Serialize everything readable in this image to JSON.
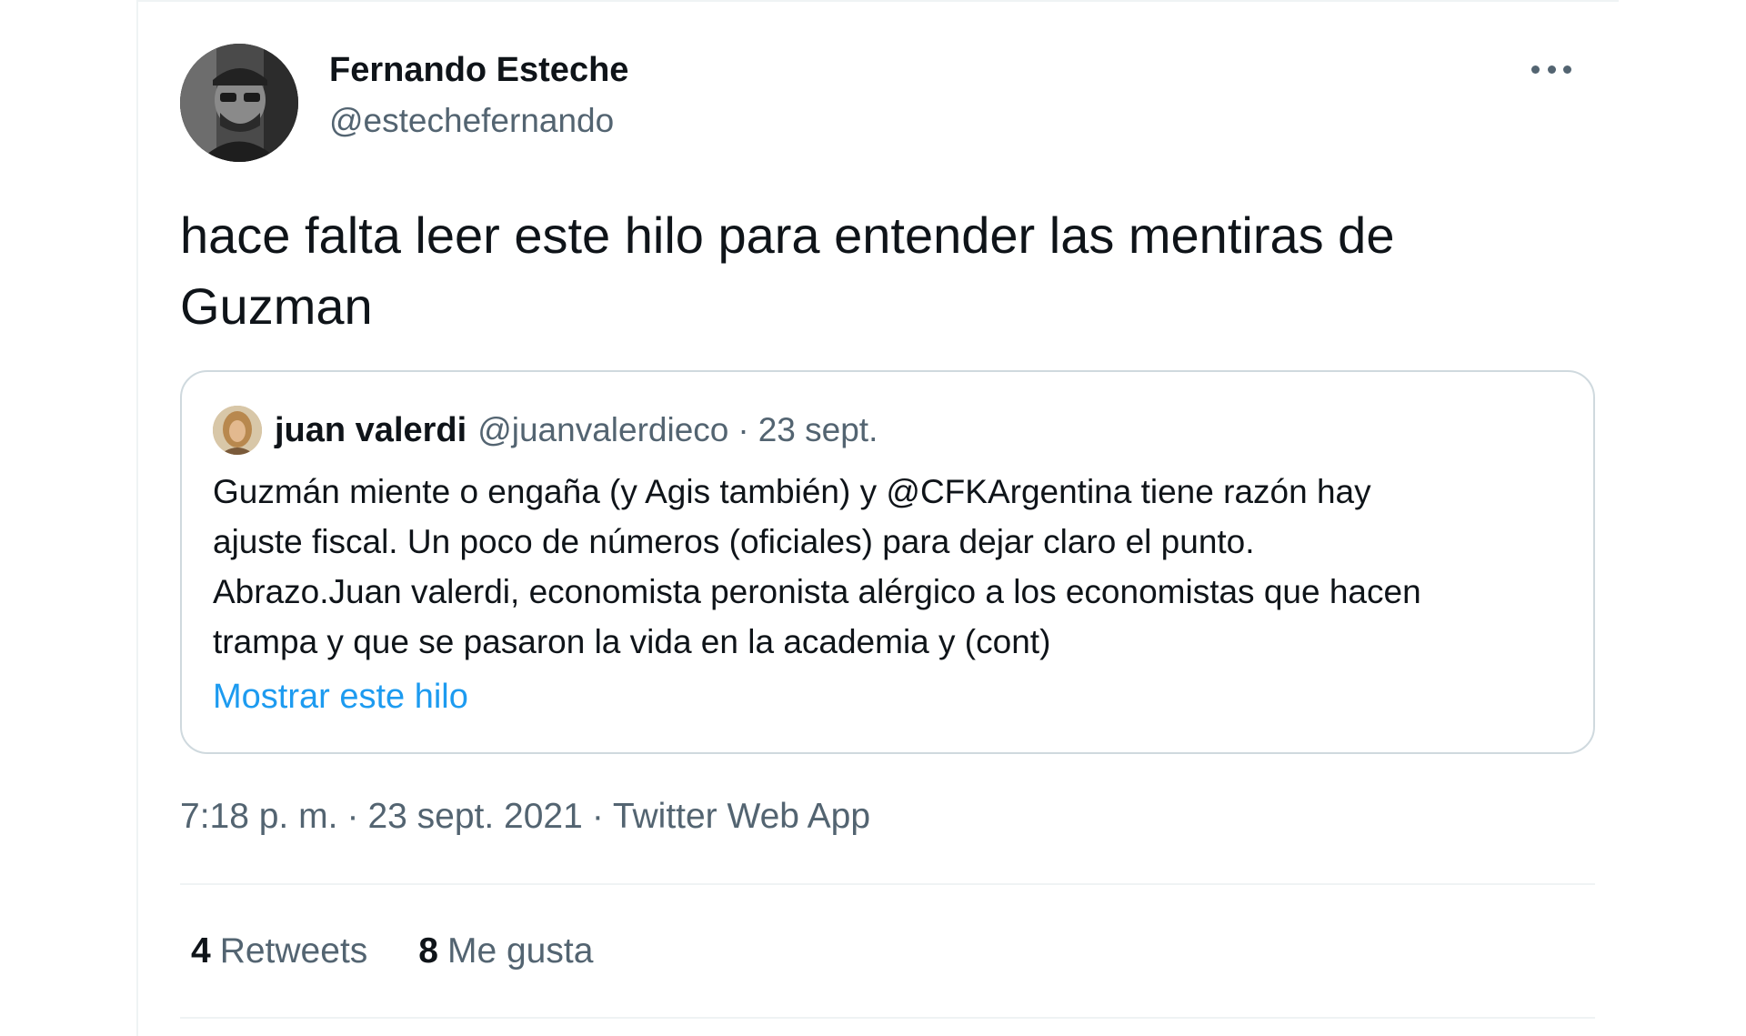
{
  "tweet": {
    "author_name": "Fernando Esteche",
    "author_handle": "@estechefernando",
    "more_icon": "more-horizontal-icon",
    "text_line1": "hace falta leer este hilo para entender las mentiras de",
    "text_line2": "Guzman",
    "quoted": {
      "author_name": "juan valerdi",
      "author_handle": "@juanvalerdieco",
      "separator": "·",
      "date": "23 sept.",
      "text_lines": [
        "Guzmán miente o engaña (y Agis también) y @CFKArgentina tiene razón hay",
        "ajuste fiscal. Un poco de números (oficiales) para dejar claro el punto.",
        "Abrazo.Juan valerdi, economista peronista alérgico a los economistas que hacen",
        "trampa y que se pasaron la vida en la academia y (cont)"
      ],
      "show_thread_label": "Mostrar este hilo"
    },
    "time": "7:18 p. m.",
    "date": "23 sept. 2021",
    "separator": "·",
    "source": "Twitter Web App",
    "retweets_count": "4",
    "retweets_label": "Retweets",
    "likes_count": "8",
    "likes_label": "Me gusta"
  },
  "colors": {
    "text_primary": "#0f1419",
    "text_secondary": "#536471",
    "link": "#1d9bf0",
    "border": "#cfd9de",
    "divider": "#eff3f4"
  }
}
